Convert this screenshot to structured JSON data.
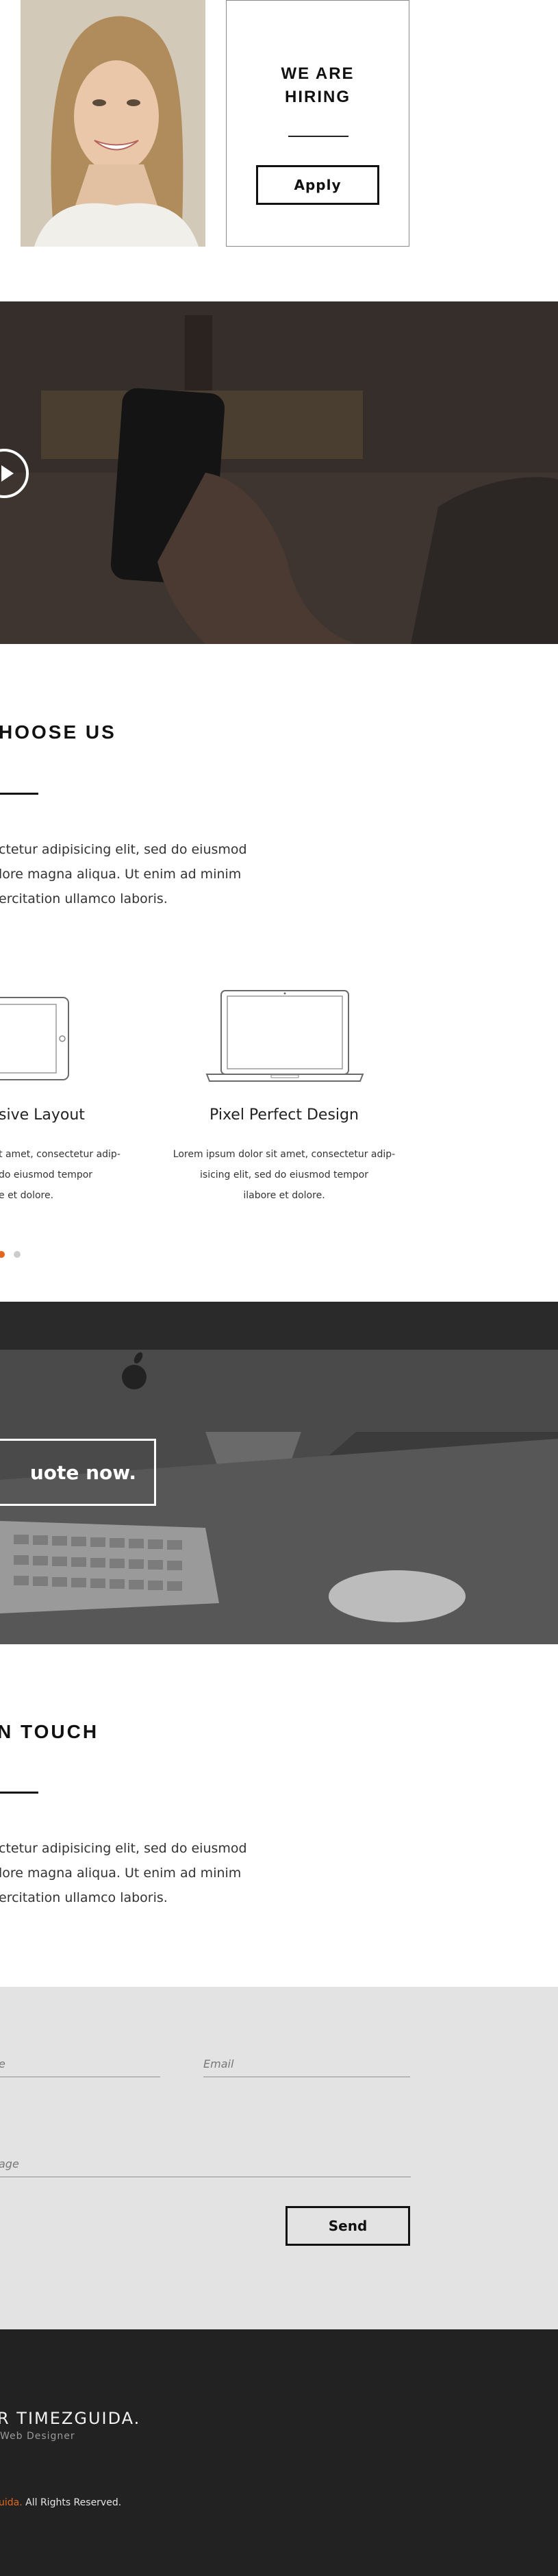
{
  "hiring": {
    "title_line1": "WE ARE",
    "title_line2": "HIRING",
    "apply_label": "Apply"
  },
  "video": {
    "play_icon": "play-icon"
  },
  "why_us": {
    "title": "HOOSE US",
    "paragraph": [
      "ctetur adipisicing elit, sed do eiusmod",
      "lore magna aliqua. Ut enim ad minim",
      "ercitation ullamco laboris."
    ]
  },
  "features": [
    {
      "icon": "tablet-icon",
      "title": "sive Layout",
      "text": [
        "t amet, consectetur adip-",
        "do eiusmod tempor",
        "e et dolore."
      ]
    },
    {
      "icon": "laptop-icon",
      "title": "Pixel Perfect Design",
      "text": [
        "Lorem ipsum dolor sit amet, consectetur adip-",
        "isicing elit, sed do eiusmod tempor",
        "ilabore et dolore."
      ]
    }
  ],
  "carousel": {
    "active_color": "#e2661e",
    "inactive_color": "#cccccc"
  },
  "quote": {
    "button_label": "uote now."
  },
  "contact": {
    "title": "N TOUCH",
    "paragraph": [
      "ctetur adipisicing elit, sed do eiusmod",
      "lore magna aliqua. Ut enim ad minim",
      "ercitation ullamco laboris."
    ],
    "name_placeholder": "e",
    "email_placeholder": "Email",
    "message_placeholder": "age",
    "send_label": "Send"
  },
  "footer": {
    "brand": "R TIMEZGUIDA.",
    "subtitle": "Web Designer",
    "copyright_brand": "uida.",
    "copyright_rest": "All Rights Reserved.",
    "accent_color": "#e2661e",
    "background_color": "#222222"
  }
}
